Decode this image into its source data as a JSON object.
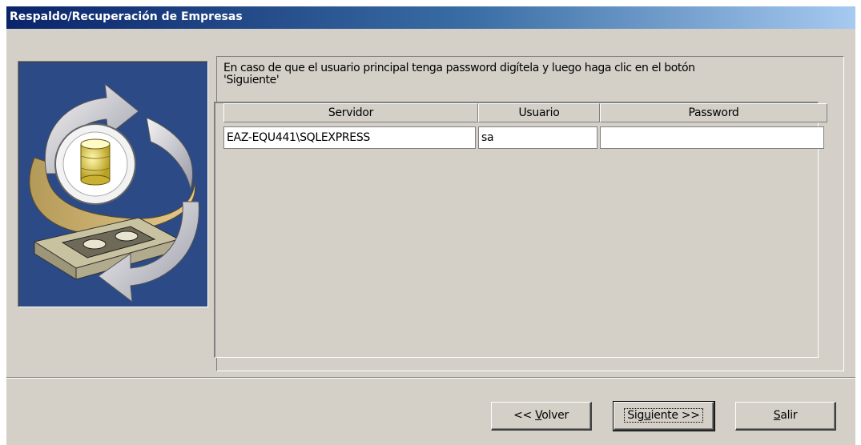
{
  "window": {
    "title": "Respaldo/Recuperación de Empresas"
  },
  "instructions": {
    "line1": "En caso de que el usuario principal tenga password digítela y luego haga clic en el botón",
    "line2": "'Siguiente'"
  },
  "grid": {
    "columns": [
      "Servidor",
      "Usuario",
      "Password"
    ],
    "rows": [
      {
        "servidor": "EAZ-EQU441\\SQLEXPRESS",
        "usuario": "sa",
        "password": ""
      }
    ]
  },
  "buttons": {
    "back": {
      "prefix": "<< ",
      "mnemonic": "V",
      "rest": "olver"
    },
    "next": {
      "prefix": "Sig",
      "mnemonic": "u",
      "rest": "iente >>"
    },
    "exit": {
      "prefix": "",
      "mnemonic": "S",
      "rest": "alir"
    }
  },
  "icons": {
    "wizard_image": "database-backup-illustration"
  },
  "colors": {
    "title_start": "#0a246a",
    "title_end": "#a6caf0",
    "face": "#d4d0c8",
    "image_bg": "#2c4a86"
  }
}
